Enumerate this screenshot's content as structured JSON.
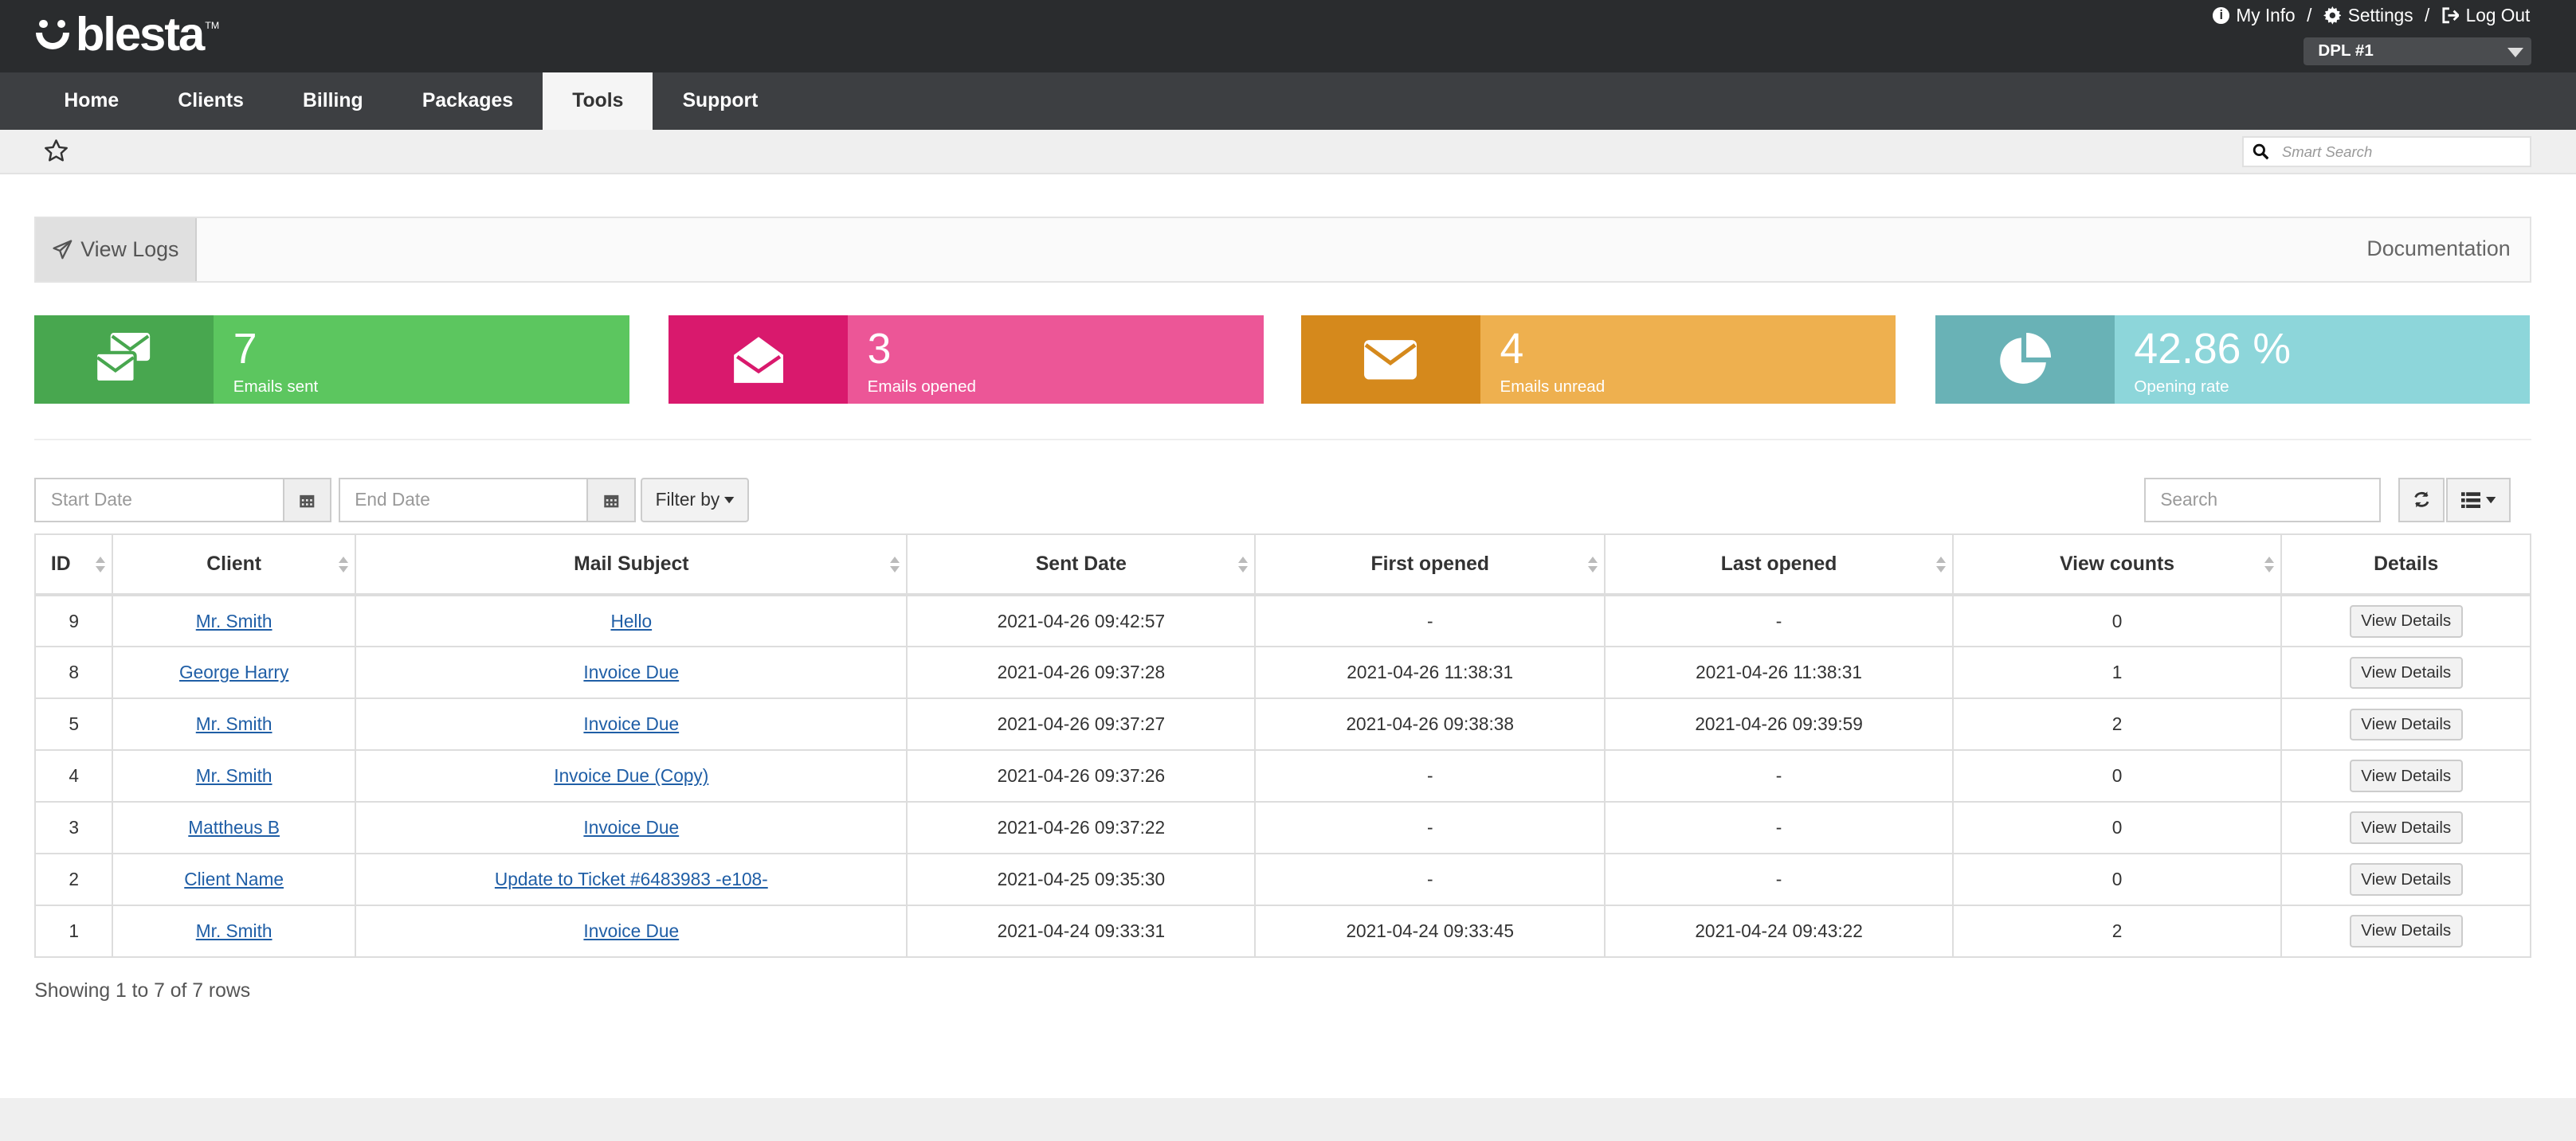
{
  "header": {
    "logo_text": "blesta",
    "logo_tm": "TM",
    "links": [
      {
        "label": "My Info",
        "icon": "info-icon"
      },
      {
        "label": "Settings",
        "icon": "gear-icon"
      },
      {
        "label": "Log Out",
        "icon": "logout-icon"
      }
    ],
    "separator": "/",
    "company": "DPL #1"
  },
  "nav": {
    "items": [
      "Home",
      "Clients",
      "Billing",
      "Packages",
      "Tools",
      "Support"
    ],
    "active": "Tools"
  },
  "smart_search": {
    "placeholder": "Smart Search"
  },
  "panel": {
    "view_logs_label": "View Logs",
    "documentation_label": "Documentation"
  },
  "stats": [
    {
      "value": "7",
      "label": "Emails sent",
      "color_icon": "#48a74f",
      "color_body": "#5cc65f",
      "icon": "envelopes-icon"
    },
    {
      "value": "3",
      "label": "Emails opened",
      "color_icon": "#d9196d",
      "color_body": "#ec5697",
      "icon": "envelope-open-icon"
    },
    {
      "value": "4",
      "label": "Emails unread",
      "color_icon": "#d5891c",
      "color_body": "#eeb04f",
      "icon": "envelope-icon"
    },
    {
      "value": "42.86 %",
      "label": "Opening rate",
      "color_icon": "#69b2b6",
      "color_body": "#8dd6da",
      "icon": "pie-chart-icon"
    }
  ],
  "toolbar": {
    "start_date_placeholder": "Start Date",
    "end_date_placeholder": "End Date",
    "filter_label": "Filter by",
    "search_placeholder": "Search"
  },
  "table": {
    "columns": [
      "ID",
      "Client",
      "Mail Subject",
      "Sent Date",
      "First opened",
      "Last opened",
      "View counts",
      "Details"
    ],
    "rows": [
      {
        "id": "9",
        "client": "Mr. Smith",
        "subject": "Hello",
        "sent": "2021-04-26 09:42:57",
        "first": "-",
        "last": "-",
        "views": "0",
        "details": "View Details"
      },
      {
        "id": "8",
        "client": "George Harry",
        "subject": "Invoice Due",
        "sent": "2021-04-26 09:37:28",
        "first": "2021-04-26 11:38:31",
        "last": "2021-04-26 11:38:31",
        "views": "1",
        "details": "View Details"
      },
      {
        "id": "5",
        "client": "Mr. Smith",
        "subject": "Invoice Due",
        "sent": "2021-04-26 09:37:27",
        "first": "2021-04-26 09:38:38",
        "last": "2021-04-26 09:39:59",
        "views": "2",
        "details": "View Details"
      },
      {
        "id": "4",
        "client": "Mr. Smith",
        "subject": "Invoice Due (Copy)",
        "sent": "2021-04-26 09:37:26",
        "first": "-",
        "last": "-",
        "views": "0",
        "details": "View Details"
      },
      {
        "id": "3",
        "client": "Mattheus B",
        "subject": "Invoice Due",
        "sent": "2021-04-26 09:37:22",
        "first": "-",
        "last": "-",
        "views": "0",
        "details": "View Details"
      },
      {
        "id": "2",
        "client": "Client Name",
        "subject": "Update to Ticket #6483983 -e108-",
        "sent": "2021-04-25 09:35:30",
        "first": "-",
        "last": "-",
        "views": "0",
        "details": "View Details"
      },
      {
        "id": "1",
        "client": "Mr. Smith",
        "subject": "Invoice Due",
        "sent": "2021-04-24 09:33:31",
        "first": "2021-04-24 09:33:45",
        "last": "2021-04-24 09:43:22",
        "views": "2",
        "details": "View Details"
      }
    ]
  },
  "footer_text": "Showing 1 to 7 of 7 rows"
}
